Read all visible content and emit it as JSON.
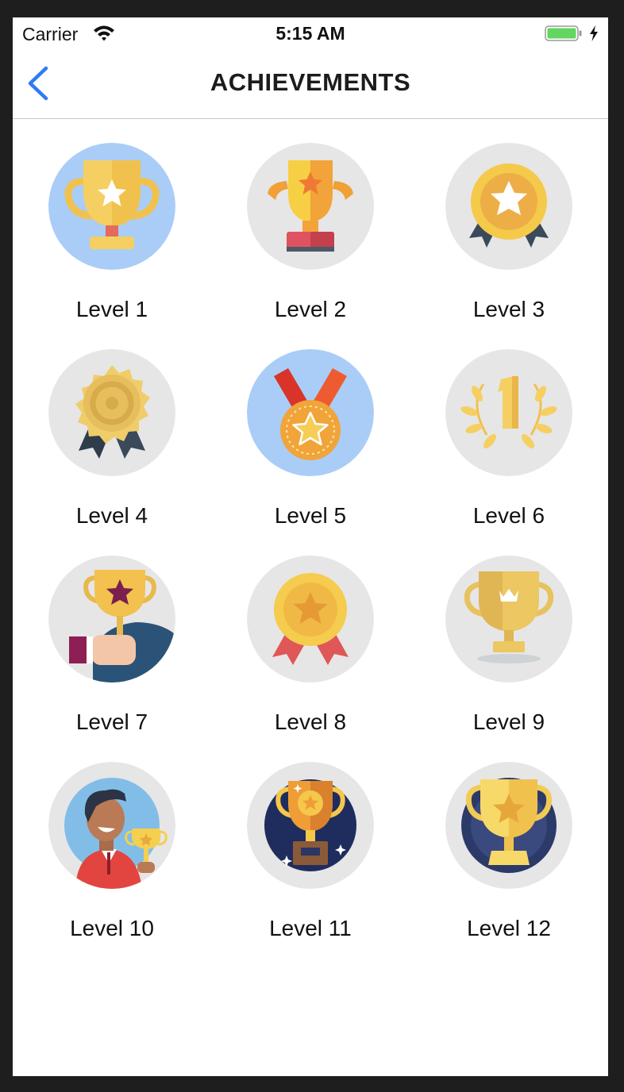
{
  "status_bar": {
    "carrier": "Carrier",
    "time": "5:15 AM",
    "icons": [
      "wifi-icon",
      "battery-icon",
      "charging-bolt-icon"
    ]
  },
  "nav": {
    "title": "ACHIEVEMENTS",
    "back_icon": "chevron-left-icon"
  },
  "colors": {
    "accent": "#2f7bf6",
    "highlight_bg": "#a9cdf7",
    "badge_bg": "#e6e6e6",
    "battery": "#62d660"
  },
  "levels": [
    {
      "label": "Level 1",
      "icon": "trophy-star-icon",
      "highlighted": true
    },
    {
      "label": "Level 2",
      "icon": "trophy-cup-icon",
      "highlighted": false
    },
    {
      "label": "Level 3",
      "icon": "star-medal-icon",
      "highlighted": false
    },
    {
      "label": "Level 4",
      "icon": "rosette-badge-icon",
      "highlighted": false
    },
    {
      "label": "Level 5",
      "icon": "ribbon-medal-icon",
      "highlighted": true
    },
    {
      "label": "Level 6",
      "icon": "laurel-number-one-icon",
      "highlighted": false
    },
    {
      "label": "Level 7",
      "icon": "hand-holding-trophy-icon",
      "highlighted": false
    },
    {
      "label": "Level 8",
      "icon": "star-rosette-icon",
      "highlighted": false
    },
    {
      "label": "Level 9",
      "icon": "crown-trophy-icon",
      "highlighted": false
    },
    {
      "label": "Level 10",
      "icon": "winner-person-icon",
      "highlighted": false
    },
    {
      "label": "Level 11",
      "icon": "trophy-night-icon",
      "highlighted": false
    },
    {
      "label": "Level 12",
      "icon": "trophy-dark-icon",
      "highlighted": false
    }
  ]
}
